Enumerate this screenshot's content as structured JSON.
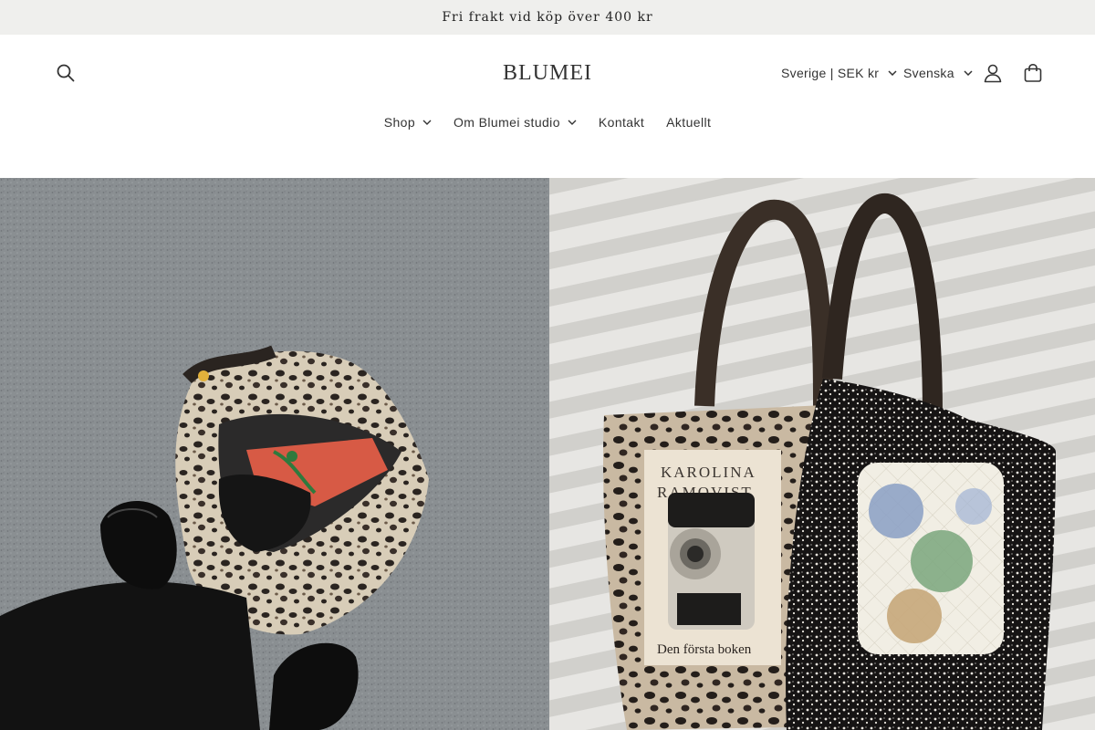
{
  "announcement": {
    "text": "Fri frakt vid köp över 400 kr"
  },
  "header": {
    "logo": "BLUMEI",
    "search_icon": "search-icon",
    "country_selector": "Sverige | SEK kr",
    "language_selector": "Svenska",
    "account_icon": "user-icon",
    "cart_icon": "shopping-bag-icon"
  },
  "nav": {
    "items": [
      {
        "label": "Shop",
        "has_dropdown": true
      },
      {
        "label": "Om Blumei studio",
        "has_dropdown": true
      },
      {
        "label": "Kontakt",
        "has_dropdown": false
      },
      {
        "label": "Aktuellt",
        "has_dropdown": false
      }
    ]
  },
  "hero": {
    "left_image": "leopard-tote-bag-on-asphalt-photo",
    "right_image": "leopard-and-floral-tote-bags-on-bedsheet-photo",
    "book_title": "KAROLINA RAMQVIST",
    "book_subtitle": "Den första boken"
  },
  "colors": {
    "announcement_bg": "#efefed",
    "text": "#2b2b2b",
    "background": "#ffffff"
  }
}
